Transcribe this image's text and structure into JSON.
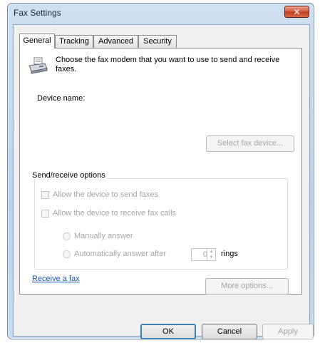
{
  "window": {
    "title": "Fax Settings",
    "close_glyph": "✕"
  },
  "tabs": [
    {
      "label": "General",
      "active": true
    },
    {
      "label": "Tracking",
      "active": false
    },
    {
      "label": "Advanced",
      "active": false
    },
    {
      "label": "Security",
      "active": false
    }
  ],
  "general": {
    "intro_text": "Choose the fax modem that you want to use to send and receive faxes.",
    "device_name_label": "Device name:",
    "select_device_label": "Select fax device...",
    "send_receive_legend": "Send/receive options",
    "allow_send_label": "Allow the device to send faxes",
    "allow_receive_label": "Allow the device to receive fax calls",
    "manual_answer_label": "Manually answer",
    "auto_answer_label": "Automatically answer after",
    "rings_value": "0",
    "rings_label": "rings",
    "more_options_label": "More options...",
    "receive_fax_link": "Receive a fax"
  },
  "buttons": {
    "ok": "OK",
    "cancel": "Cancel",
    "apply": "Apply"
  },
  "icons": {
    "fax": "fax-machine-icon",
    "spin_up": "▲",
    "spin_down": "▼"
  }
}
